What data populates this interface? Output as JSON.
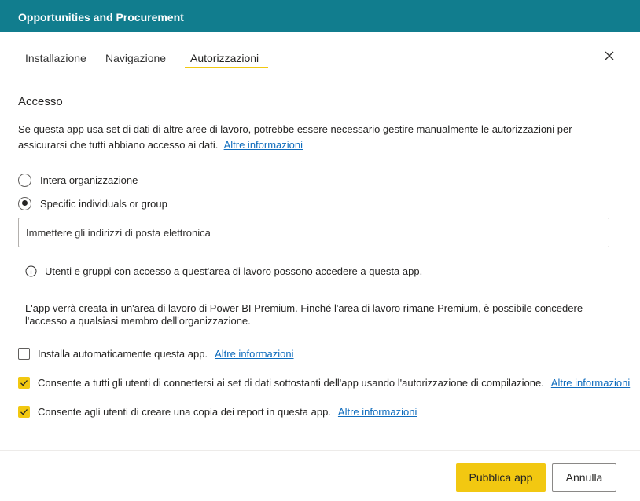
{
  "header": {
    "title": "Opportunities and Procurement"
  },
  "tabs": [
    {
      "label": "Installazione"
    },
    {
      "label": "Navigazione"
    },
    {
      "label": "Autorizzazioni"
    }
  ],
  "access": {
    "section_title": "Accesso",
    "description": "Se questa app usa set di dati di altre aree di lavoro, potrebbe essere necessario gestire manualmente le autorizzazioni per assicurarsi che tutti abbiano accesso ai dati.",
    "learn_more": "Altre informazioni",
    "options": [
      {
        "label": "Intera organizzazione",
        "selected": false
      },
      {
        "label": "Specific individuals or group",
        "selected": true
      }
    ],
    "email_placeholder": "Immettere gli indirizzi di posta elettronica",
    "info_text": "Utenti e gruppi con accesso a quest'area di lavoro possono accedere a questa app.",
    "premium_text": "L'app verrà creata in un'area di lavoro di Power BI Premium. Finché l'area di lavoro rimane Premium, è possibile concedere l'accesso a qualsiasi membro dell'organizzazione."
  },
  "checkboxes": [
    {
      "label": "Installa automaticamente questa app.",
      "link": "Altre informazioni",
      "checked": false
    },
    {
      "label": "Consente a tutti gli utenti di connettersi ai set di dati sottostanti dell'app usando l'autorizzazione di compilazione.",
      "link": "Altre informazioni",
      "checked": true
    },
    {
      "label": "Consente agli utenti di creare una copia dei report in questa app.",
      "link": "Altre informazioni",
      "checked": true
    }
  ],
  "footer": {
    "publish_label": "Pubblica app",
    "cancel_label": "Annulla"
  },
  "colors": {
    "header": "#117d8e",
    "accent": "#f2c811",
    "link": "#0f6cbd"
  }
}
